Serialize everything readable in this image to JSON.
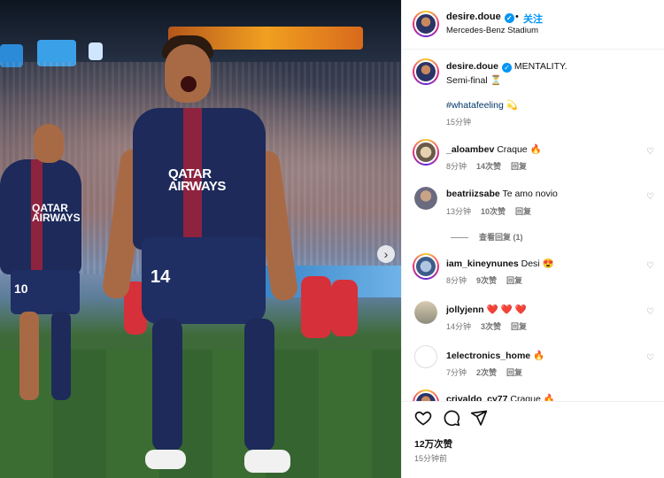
{
  "post": {
    "username": "desire.doue",
    "follow_label": "关注",
    "location": "Mercedes-Benz Stadium",
    "caption_text": "MENTALITY.",
    "caption_line2": "Semi-final ⏳",
    "hashtag": "#whatafeeling 💫",
    "caption_time": "15分钟",
    "likes": "12万次赞",
    "posted_time": "15分钟前"
  },
  "photo": {
    "shirt_text": "QATAR AIRWAYS",
    "player_number": "14",
    "player2_number": "10"
  },
  "comments": [
    {
      "username": "_aloambev",
      "text": "Craque 🔥",
      "time": "8分钟",
      "likes": "14次赞",
      "reply": "回复"
    },
    {
      "username": "beatriizsabe",
      "text": "Te amo novio",
      "time": "13分钟",
      "likes": "10次赞",
      "reply": "回复"
    },
    {
      "username": "iam_kineynunes",
      "text": "Desi 😍",
      "time": "8分钟",
      "likes": "9次赞",
      "reply": "回复"
    },
    {
      "username": "jollyjenn",
      "text": "❤️ ❤️ ❤️",
      "time": "14分钟",
      "likes": "3次赞",
      "reply": "回复"
    },
    {
      "username": "1electronics_home",
      "text": "🔥",
      "time": "7分钟",
      "likes": "2次赞",
      "reply": "回复"
    },
    {
      "username": "crivaldo_cy77",
      "text": "Craque 🔥"
    }
  ],
  "view_replies": "查看回复 (1)",
  "icons": [
    "heart-icon",
    "comment-icon",
    "share-icon",
    "chevron-right-icon",
    "verified-icon"
  ],
  "colors": {
    "accent": "#0095f6",
    "psg_navy": "#1d2a5a",
    "psg_red": "#8e2340"
  }
}
